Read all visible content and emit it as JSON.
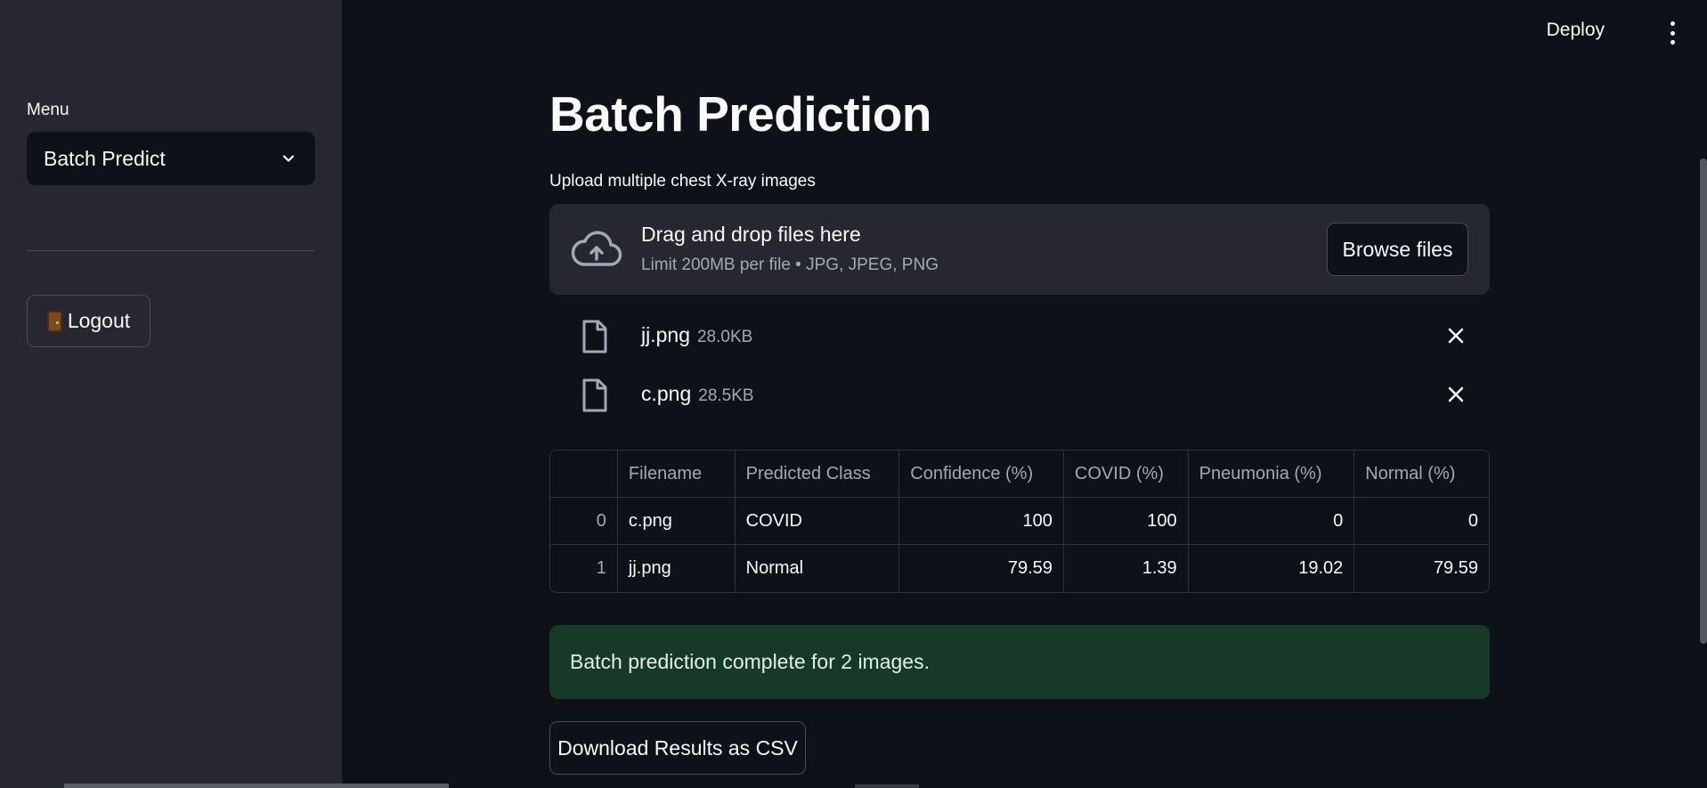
{
  "sidebar": {
    "menu_label": "Menu",
    "menu_selected": "Batch Predict",
    "logout_label": "Logout"
  },
  "header": {
    "deploy_label": "Deploy"
  },
  "main": {
    "title": "Batch Prediction",
    "upload_label": "Upload multiple chest X-ray images",
    "dropzone": {
      "title": "Drag and drop files here",
      "subtitle": "Limit 200MB per file • JPG, JPEG, PNG",
      "browse_label": "Browse files"
    },
    "files": [
      {
        "name": "jj.png",
        "size": "28.0KB"
      },
      {
        "name": "c.png",
        "size": "28.5KB"
      }
    ],
    "table": {
      "columns": [
        "",
        "Filename",
        "Predicted Class",
        "Confidence (%)",
        "COVID (%)",
        "Pneumonia (%)",
        "Normal (%)"
      ],
      "rows": [
        [
          "0",
          "c.png",
          "COVID",
          "100",
          "100",
          "0",
          "0"
        ],
        [
          "1",
          "jj.png",
          "Normal",
          "79.59",
          "1.39",
          "19.02",
          "79.59"
        ]
      ]
    },
    "success_message": "Batch prediction complete for 2 images.",
    "download_label": "Download Results as CSV"
  },
  "colors": {
    "background": "#0e1117",
    "sidebar": "#262730",
    "success_bg": "#173928"
  }
}
